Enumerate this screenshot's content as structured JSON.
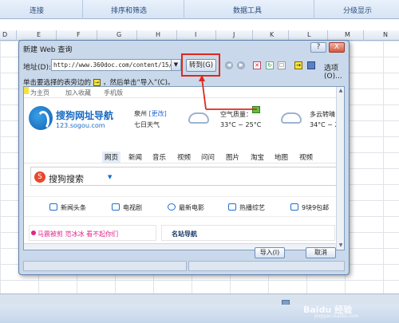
{
  "ribbon": {
    "groups": [
      "连接",
      "排序和筛选",
      "数据工具",
      "分级显示"
    ]
  },
  "columns": [
    "D",
    "E",
    "F",
    "G",
    "H",
    "I",
    "J",
    "K",
    "L",
    "M",
    "N"
  ],
  "dialog": {
    "title": "新建 Web 查询",
    "help_button": "?",
    "close_button": "X",
    "address_label": "地址(D):",
    "address_value": "http://www.360doc.com/content/15/0129",
    "go_button": "转到(G)",
    "options_label": "选项(O)...",
    "hint": {
      "before": "单击要选择的表旁边的",
      "after": "，然后单击“导入”(C)。"
    },
    "import_button": "导入(I)",
    "cancel_button": "取消"
  },
  "web": {
    "top_links": [
      "为主页",
      "加入收藏",
      "手机版"
    ],
    "brand": "搜狗网址导航",
    "brand_url": "123.sogou.com",
    "city": "泉州",
    "city_change": "[更改]",
    "days": "七日天气",
    "air_quality": "空气质量：",
    "temp1": "33°C ~ 25°C",
    "weather2": "多云转晴",
    "temp2": "34°C ~ 25°",
    "nav": [
      "网页",
      "新闻",
      "音乐",
      "视频",
      "问问",
      "图片",
      "淘宝",
      "地图",
      "视频"
    ],
    "search_label": "搜狗搜索",
    "quick_links": [
      "新闻头条",
      "电视剧",
      "最新电影",
      "热播综艺",
      "9块9包邮"
    ],
    "promo": "马震被剪 范冰冰 看不起你们",
    "famous_sites": "名站导航"
  },
  "watermark": "Baidu 经验",
  "watermark_url": "jingyan.baidu.com"
}
